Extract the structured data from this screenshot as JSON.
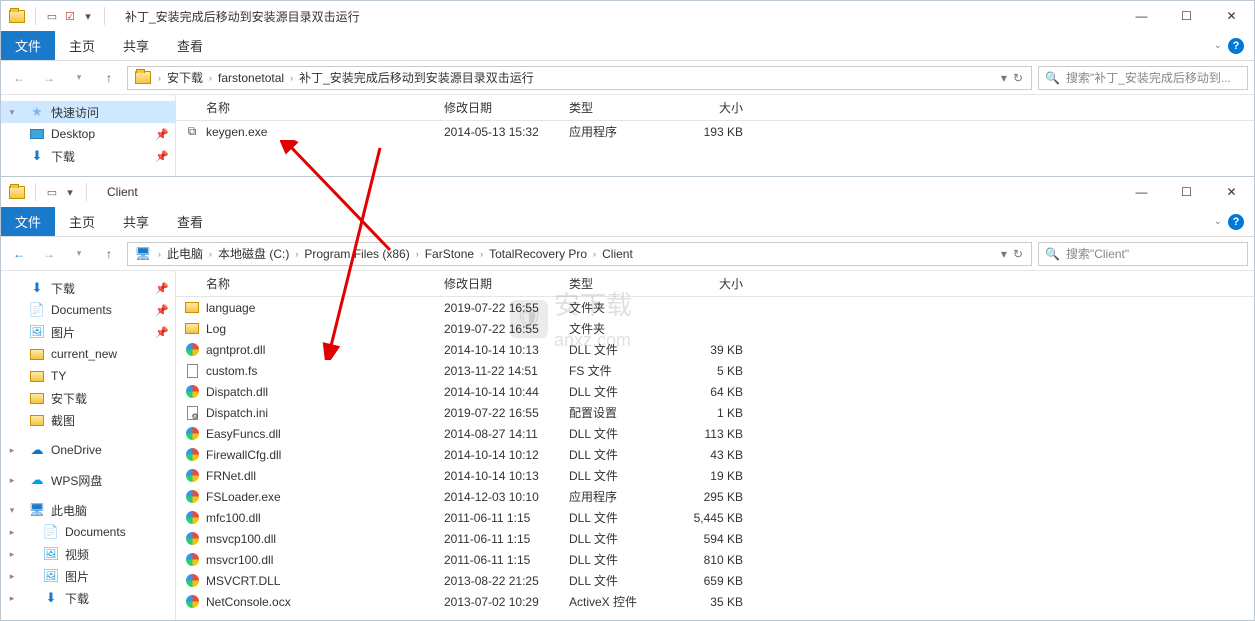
{
  "window1": {
    "title": "补丁_安装完成后移动到安装源目录双击运行",
    "ribbon": {
      "file": "文件",
      "tabs": [
        "主页",
        "共享",
        "查看"
      ]
    },
    "breadcrumb": [
      "安下载",
      "farstonetotal",
      "补丁_安装完成后移动到安装源目录双击运行"
    ],
    "search_placeholder": "搜索\"补丁_安装完成后移动到...",
    "columns": [
      "名称",
      "修改日期",
      "类型",
      "大小"
    ],
    "sidebar": [
      {
        "label": "快速访问",
        "icon": "star",
        "selected": true,
        "caret": "▾"
      },
      {
        "label": "Desktop",
        "icon": "desktop",
        "pin": true,
        "caret": ""
      },
      {
        "label": "下载",
        "icon": "download",
        "pin": true,
        "caret": ""
      }
    ],
    "files": [
      {
        "name": "keygen.exe",
        "date": "2014-05-13 15:32",
        "type": "应用程序",
        "size": "193 KB",
        "icon": "exe"
      }
    ]
  },
  "window2": {
    "title": "Client",
    "ribbon": {
      "file": "文件",
      "tabs": [
        "主页",
        "共享",
        "查看"
      ]
    },
    "breadcrumb": [
      "此电脑",
      "本地磁盘 (C:)",
      "Program Files (x86)",
      "FarStone",
      "TotalRecovery Pro",
      "Client"
    ],
    "search_placeholder": "搜索\"Client\"",
    "columns": [
      "名称",
      "修改日期",
      "类型",
      "大小"
    ],
    "sidebar": [
      {
        "label": "下载",
        "icon": "download",
        "pin": true,
        "caret": ""
      },
      {
        "label": "Documents",
        "icon": "doc",
        "pin": true,
        "caret": ""
      },
      {
        "label": "图片",
        "icon": "pic",
        "pin": true,
        "caret": ""
      },
      {
        "label": "current_new",
        "icon": "folder",
        "caret": ""
      },
      {
        "label": "TY",
        "icon": "folder",
        "caret": ""
      },
      {
        "label": "安下载",
        "icon": "folder",
        "caret": ""
      },
      {
        "label": "截图",
        "icon": "folder",
        "caret": ""
      },
      {
        "label": "",
        "spacer": true
      },
      {
        "label": "OneDrive",
        "icon": "cloud",
        "caret": "▸"
      },
      {
        "label": "",
        "spacer": true
      },
      {
        "label": "WPS网盘",
        "icon": "wps",
        "caret": "▸"
      },
      {
        "label": "",
        "spacer": true
      },
      {
        "label": "此电脑",
        "icon": "pc",
        "caret": "▾"
      },
      {
        "label": "Documents",
        "icon": "doc",
        "caret": "▸",
        "indent": true
      },
      {
        "label": "视频",
        "icon": "pic",
        "caret": "▸",
        "indent": true
      },
      {
        "label": "图片",
        "icon": "pic",
        "caret": "▸",
        "indent": true
      },
      {
        "label": "下载",
        "icon": "download",
        "caret": "▸",
        "indent": true
      }
    ],
    "files": [
      {
        "name": "language",
        "date": "2019-07-22 16:55",
        "type": "文件夹",
        "size": "",
        "icon": "folder"
      },
      {
        "name": "Log",
        "date": "2019-07-22 16:55",
        "type": "文件夹",
        "size": "",
        "icon": "folder"
      },
      {
        "name": "agntprot.dll",
        "date": "2014-10-14 10:13",
        "type": "DLL 文件",
        "size": "39 KB",
        "icon": "dll"
      },
      {
        "name": "custom.fs",
        "date": "2013-11-22 14:51",
        "type": "FS 文件",
        "size": "5 KB",
        "icon": "file"
      },
      {
        "name": "Dispatch.dll",
        "date": "2014-10-14 10:44",
        "type": "DLL 文件",
        "size": "64 KB",
        "icon": "dll"
      },
      {
        "name": "Dispatch.ini",
        "date": "2019-07-22 16:55",
        "type": "配置设置",
        "size": "1 KB",
        "icon": "ini"
      },
      {
        "name": "EasyFuncs.dll",
        "date": "2014-08-27 14:11",
        "type": "DLL 文件",
        "size": "113 KB",
        "icon": "dll"
      },
      {
        "name": "FirewallCfg.dll",
        "date": "2014-10-14 10:12",
        "type": "DLL 文件",
        "size": "43 KB",
        "icon": "dll"
      },
      {
        "name": "FRNet.dll",
        "date": "2014-10-14 10:13",
        "type": "DLL 文件",
        "size": "19 KB",
        "icon": "dll"
      },
      {
        "name": "FSLoader.exe",
        "date": "2014-12-03 10:10",
        "type": "应用程序",
        "size": "295 KB",
        "icon": "dll"
      },
      {
        "name": "mfc100.dll",
        "date": "2011-06-11 1:15",
        "type": "DLL 文件",
        "size": "5,445 KB",
        "icon": "dll"
      },
      {
        "name": "msvcp100.dll",
        "date": "2011-06-11 1:15",
        "type": "DLL 文件",
        "size": "594 KB",
        "icon": "dll"
      },
      {
        "name": "msvcr100.dll",
        "date": "2011-06-11 1:15",
        "type": "DLL 文件",
        "size": "810 KB",
        "icon": "dll"
      },
      {
        "name": "MSVCRT.DLL",
        "date": "2013-08-22 21:25",
        "type": "DLL 文件",
        "size": "659 KB",
        "icon": "dll"
      },
      {
        "name": "NetConsole.ocx",
        "date": "2013-07-02 10:29",
        "type": "ActiveX 控件",
        "size": "35 KB",
        "icon": "dll"
      }
    ]
  },
  "watermark": {
    "text1": "安下载",
    "text2": "anxz.com"
  }
}
